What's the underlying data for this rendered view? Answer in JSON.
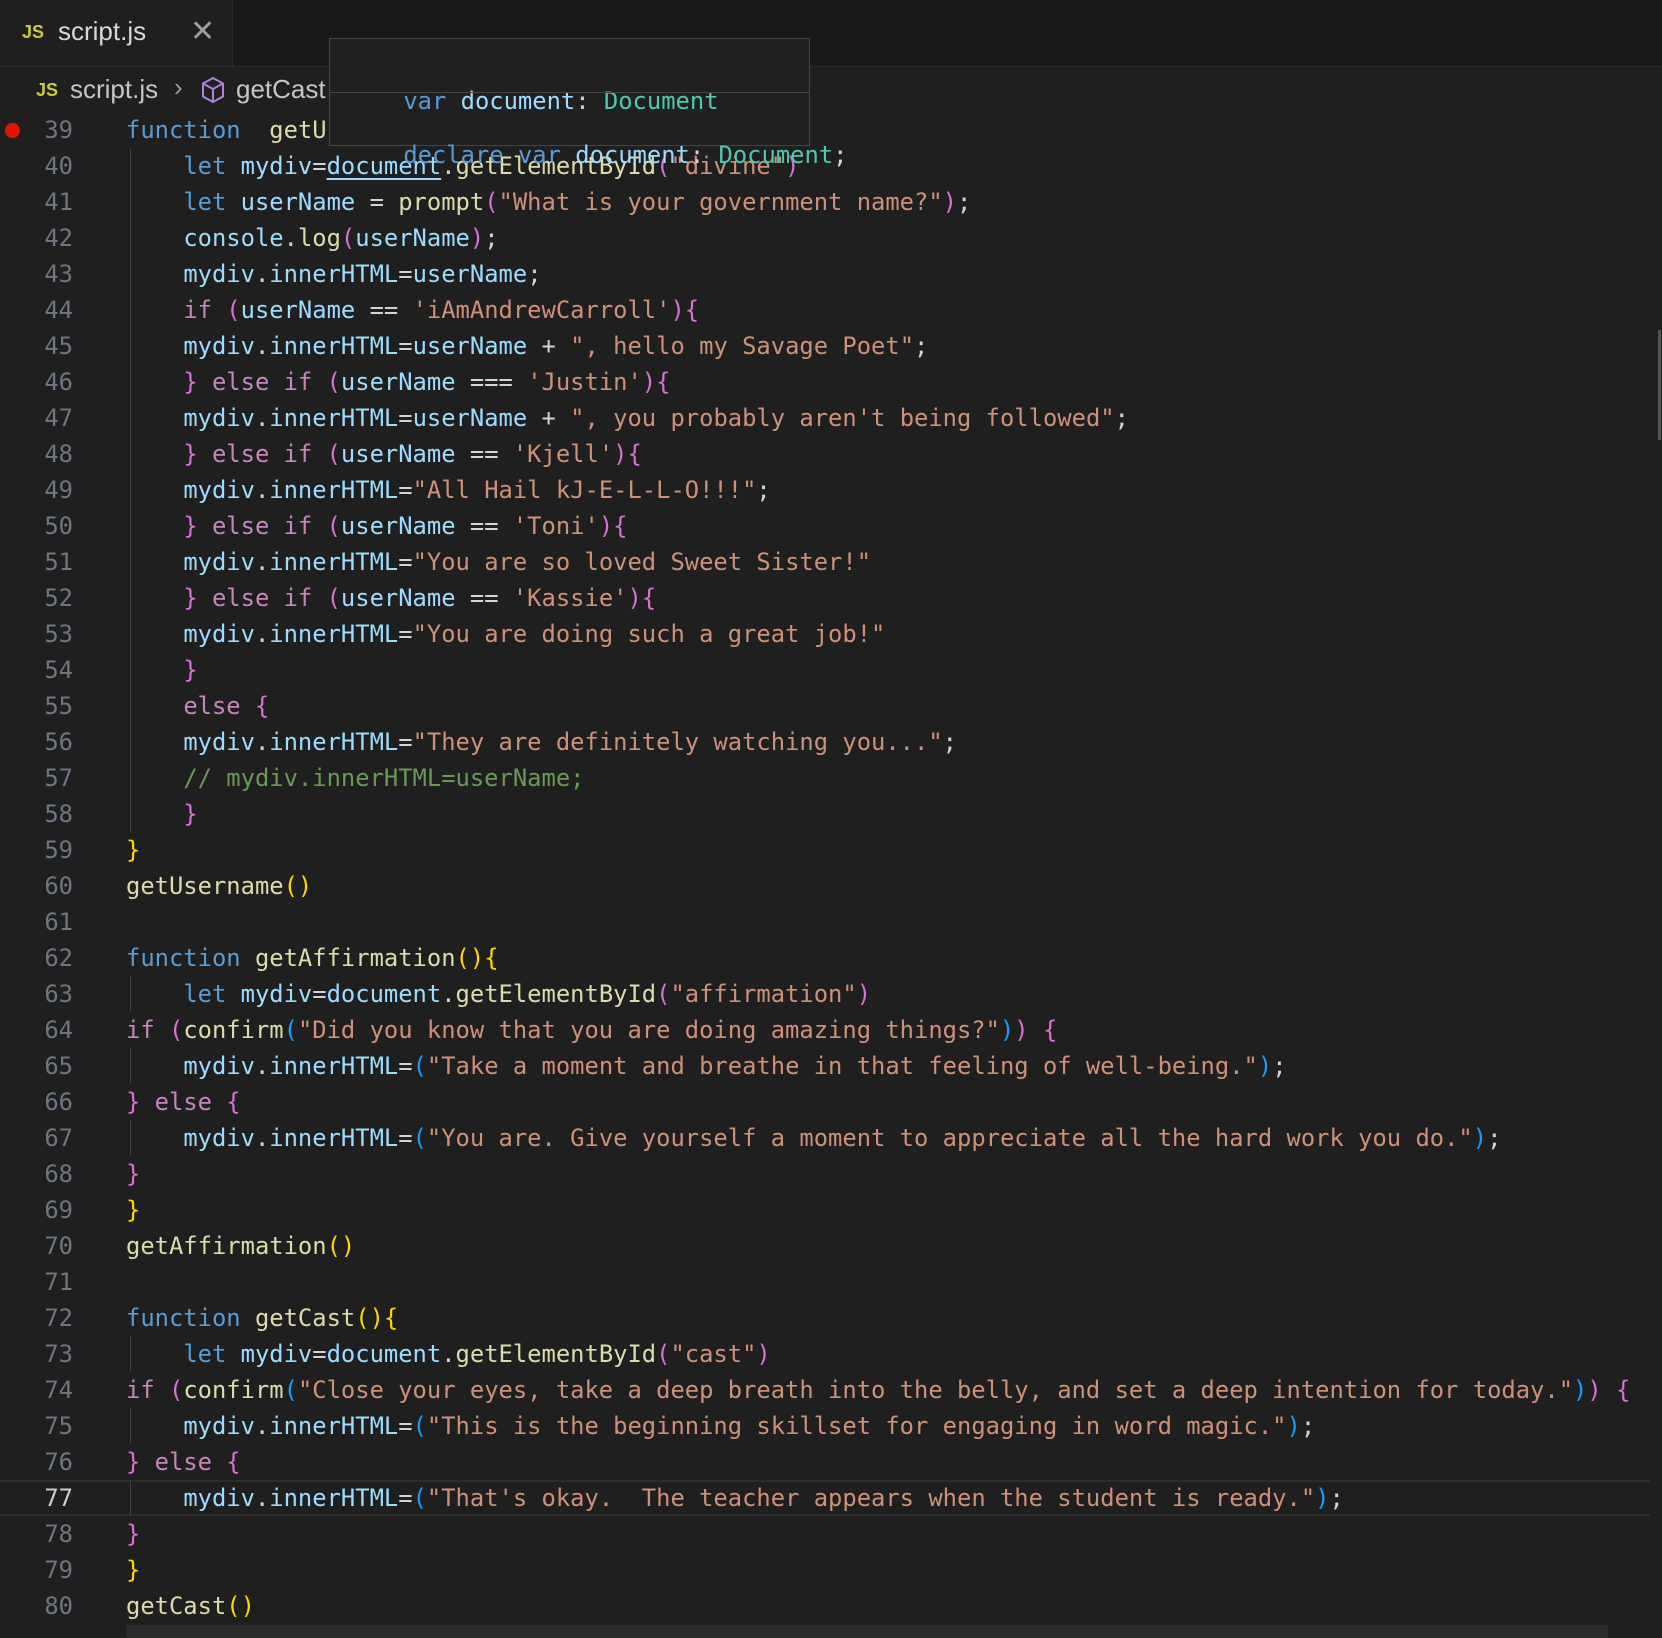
{
  "tab": {
    "icon": "JS",
    "title": "script.js",
    "close": "✕"
  },
  "breadcrumb": {
    "icon": "JS",
    "file": "script.js",
    "separator": "›",
    "symbol_icon": "symbol-method-icon",
    "symbol": "getCast"
  },
  "hover": {
    "line1": [
      "var",
      " ",
      "document",
      ": ",
      "Document"
    ],
    "line2": [
      "declare",
      " ",
      "var",
      " ",
      "document",
      ": ",
      "Document",
      ";"
    ]
  },
  "editor": {
    "current_line": 77,
    "breakpoint_line": 39,
    "lines": [
      {
        "n": "39",
        "t": [
          [
            "kw",
            "function"
          ],
          [
            "",
            "  "
          ],
          [
            "fn",
            "getUs"
          ]
        ]
      },
      {
        "n": "40",
        "t": [
          [
            "",
            "    "
          ],
          [
            "kw",
            "let"
          ],
          [
            "",
            " "
          ],
          [
            "var",
            "mydiv"
          ],
          [
            "",
            "="
          ],
          [
            "var ul",
            "document"
          ],
          [
            "",
            "."
          ],
          [
            "fn",
            "getElementById"
          ],
          [
            "p2",
            "("
          ],
          [
            "str",
            "\"divine\""
          ],
          [
            "p2",
            ")"
          ]
        ]
      },
      {
        "n": "41",
        "t": [
          [
            "",
            "    "
          ],
          [
            "kw",
            "let"
          ],
          [
            "",
            " "
          ],
          [
            "var",
            "userName"
          ],
          [
            "",
            " = "
          ],
          [
            "fn",
            "prompt"
          ],
          [
            "p2",
            "("
          ],
          [
            "str",
            "\"What is your government name?\""
          ],
          [
            "p2",
            ")"
          ],
          [
            "",
            ";"
          ]
        ]
      },
      {
        "n": "42",
        "t": [
          [
            "",
            "    "
          ],
          [
            "var",
            "console"
          ],
          [
            "",
            "."
          ],
          [
            "fn",
            "log"
          ],
          [
            "p2",
            "("
          ],
          [
            "var",
            "userName"
          ],
          [
            "p2",
            ")"
          ],
          [
            "",
            ";"
          ]
        ]
      },
      {
        "n": "43",
        "t": [
          [
            "",
            "    "
          ],
          [
            "var",
            "mydiv"
          ],
          [
            "",
            "."
          ],
          [
            "var",
            "innerHTML"
          ],
          [
            "",
            "="
          ],
          [
            "var",
            "userName"
          ],
          [
            "",
            ";"
          ]
        ]
      },
      {
        "n": "44",
        "t": [
          [
            "",
            "    "
          ],
          [
            "ctl",
            "if"
          ],
          [
            "",
            " "
          ],
          [
            "p2",
            "("
          ],
          [
            "var",
            "userName"
          ],
          [
            "",
            " == "
          ],
          [
            "str",
            "'iAmAndrewCarroll'"
          ],
          [
            "p2",
            ")"
          ],
          [
            "p2",
            "{"
          ]
        ]
      },
      {
        "n": "45",
        "t": [
          [
            "",
            "    "
          ],
          [
            "var",
            "mydiv"
          ],
          [
            "",
            "."
          ],
          [
            "var",
            "innerHTML"
          ],
          [
            "",
            "="
          ],
          [
            "var",
            "userName"
          ],
          [
            "",
            " + "
          ],
          [
            "str",
            "\", hello my Savage Poet\""
          ],
          [
            "",
            ";"
          ]
        ]
      },
      {
        "n": "46",
        "t": [
          [
            "",
            "    "
          ],
          [
            "p2",
            "}"
          ],
          [
            "",
            " "
          ],
          [
            "ctl",
            "else if"
          ],
          [
            "",
            " "
          ],
          [
            "p2",
            "("
          ],
          [
            "var",
            "userName"
          ],
          [
            "",
            " === "
          ],
          [
            "str",
            "'Justin'"
          ],
          [
            "p2",
            ")"
          ],
          [
            "p2",
            "{"
          ]
        ]
      },
      {
        "n": "47",
        "t": [
          [
            "",
            "    "
          ],
          [
            "var",
            "mydiv"
          ],
          [
            "",
            "."
          ],
          [
            "var",
            "innerHTML"
          ],
          [
            "",
            "="
          ],
          [
            "var",
            "userName"
          ],
          [
            "",
            " + "
          ],
          [
            "str",
            "\", you probably aren't being followed\""
          ],
          [
            "",
            ";"
          ]
        ]
      },
      {
        "n": "48",
        "t": [
          [
            "",
            "    "
          ],
          [
            "p2",
            "}"
          ],
          [
            "",
            " "
          ],
          [
            "ctl",
            "else if"
          ],
          [
            "",
            " "
          ],
          [
            "p2",
            "("
          ],
          [
            "var",
            "userName"
          ],
          [
            "",
            " == "
          ],
          [
            "str",
            "'Kjell'"
          ],
          [
            "p2",
            ")"
          ],
          [
            "p2",
            "{"
          ]
        ]
      },
      {
        "n": "49",
        "t": [
          [
            "",
            "    "
          ],
          [
            "var",
            "mydiv"
          ],
          [
            "",
            "."
          ],
          [
            "var",
            "innerHTML"
          ],
          [
            "",
            "="
          ],
          [
            "str",
            "\"All Hail kJ-E-L-L-O!!!\""
          ],
          [
            "",
            ";"
          ]
        ]
      },
      {
        "n": "50",
        "t": [
          [
            "",
            "    "
          ],
          [
            "p2",
            "}"
          ],
          [
            "",
            " "
          ],
          [
            "ctl",
            "else if"
          ],
          [
            "",
            " "
          ],
          [
            "p2",
            "("
          ],
          [
            "var",
            "userName"
          ],
          [
            "",
            " == "
          ],
          [
            "str",
            "'Toni'"
          ],
          [
            "p2",
            ")"
          ],
          [
            "p2",
            "{"
          ]
        ]
      },
      {
        "n": "51",
        "t": [
          [
            "",
            "    "
          ],
          [
            "var",
            "mydiv"
          ],
          [
            "",
            "."
          ],
          [
            "var",
            "innerHTML"
          ],
          [
            "",
            "="
          ],
          [
            "str",
            "\"You are so loved Sweet Sister!\""
          ]
        ]
      },
      {
        "n": "52",
        "t": [
          [
            "",
            "    "
          ],
          [
            "p2",
            "}"
          ],
          [
            "",
            " "
          ],
          [
            "ctl",
            "else if"
          ],
          [
            "",
            " "
          ],
          [
            "p2",
            "("
          ],
          [
            "var",
            "userName"
          ],
          [
            "",
            " == "
          ],
          [
            "str",
            "'Kassie'"
          ],
          [
            "p2",
            ")"
          ],
          [
            "p2",
            "{"
          ]
        ]
      },
      {
        "n": "53",
        "t": [
          [
            "",
            "    "
          ],
          [
            "var",
            "mydiv"
          ],
          [
            "",
            "."
          ],
          [
            "var",
            "innerHTML"
          ],
          [
            "",
            "="
          ],
          [
            "str",
            "\"You are doing such a great job!\""
          ]
        ]
      },
      {
        "n": "54",
        "t": [
          [
            "",
            "    "
          ],
          [
            "p2",
            "}"
          ]
        ]
      },
      {
        "n": "55",
        "t": [
          [
            "",
            "    "
          ],
          [
            "ctl",
            "else"
          ],
          [
            "",
            " "
          ],
          [
            "p2",
            "{"
          ]
        ]
      },
      {
        "n": "56",
        "t": [
          [
            "",
            "    "
          ],
          [
            "var",
            "mydiv"
          ],
          [
            "",
            "."
          ],
          [
            "var",
            "innerHTML"
          ],
          [
            "",
            "="
          ],
          [
            "str",
            "\"They are definitely watching you...\""
          ],
          [
            "",
            ";"
          ]
        ]
      },
      {
        "n": "57",
        "t": [
          [
            "",
            "    "
          ],
          [
            "cm",
            "// mydiv.innerHTML=userName;"
          ]
        ]
      },
      {
        "n": "58",
        "t": [
          [
            "",
            "    "
          ],
          [
            "p2",
            "}"
          ]
        ]
      },
      {
        "n": "59",
        "t": [
          [
            "p1",
            "}"
          ]
        ]
      },
      {
        "n": "60",
        "t": [
          [
            "fn",
            "getUsername"
          ],
          [
            "p1",
            "()"
          ]
        ]
      },
      {
        "n": "61",
        "t": []
      },
      {
        "n": "62",
        "t": [
          [
            "kw",
            "function"
          ],
          [
            "",
            " "
          ],
          [
            "fn",
            "getAffirmation"
          ],
          [
            "p1",
            "()"
          ],
          [
            "p1",
            "{"
          ]
        ]
      },
      {
        "n": "63",
        "t": [
          [
            "",
            "    "
          ],
          [
            "kw",
            "let"
          ],
          [
            "",
            " "
          ],
          [
            "var",
            "mydiv"
          ],
          [
            "",
            "="
          ],
          [
            "var",
            "document"
          ],
          [
            "",
            "."
          ],
          [
            "fn",
            "getElementById"
          ],
          [
            "p2",
            "("
          ],
          [
            "str",
            "\"affirmation\""
          ],
          [
            "p2",
            ")"
          ]
        ]
      },
      {
        "n": "64",
        "t": [
          [
            "ctl",
            "if"
          ],
          [
            "",
            " "
          ],
          [
            "p2",
            "("
          ],
          [
            "fn",
            "confirm"
          ],
          [
            "p3",
            "("
          ],
          [
            "str",
            "\"Did you know that you are doing amazing things?\""
          ],
          [
            "p3",
            ")"
          ],
          [
            "p2",
            ")"
          ],
          [
            "",
            " "
          ],
          [
            "p2",
            "{"
          ]
        ]
      },
      {
        "n": "65",
        "t": [
          [
            "",
            "    "
          ],
          [
            "var",
            "mydiv"
          ],
          [
            "",
            "."
          ],
          [
            "var",
            "innerHTML"
          ],
          [
            "",
            "="
          ],
          [
            "p3",
            "("
          ],
          [
            "str",
            "\"Take a moment and breathe in that feeling of well-being.\""
          ],
          [
            "p3",
            ")"
          ],
          [
            "",
            ";"
          ]
        ]
      },
      {
        "n": "66",
        "t": [
          [
            "p2",
            "}"
          ],
          [
            "",
            " "
          ],
          [
            "ctl",
            "else"
          ],
          [
            "",
            " "
          ],
          [
            "p2",
            "{"
          ]
        ]
      },
      {
        "n": "67",
        "t": [
          [
            "",
            "    "
          ],
          [
            "var",
            "mydiv"
          ],
          [
            "",
            "."
          ],
          [
            "var",
            "innerHTML"
          ],
          [
            "",
            "="
          ],
          [
            "p3",
            "("
          ],
          [
            "str",
            "\"You are. Give yourself a moment to appreciate all the hard work you do.\""
          ],
          [
            "p3",
            ")"
          ],
          [
            "",
            ";"
          ]
        ]
      },
      {
        "n": "68",
        "t": [
          [
            "p2",
            "}"
          ]
        ]
      },
      {
        "n": "69",
        "t": [
          [
            "p1",
            "}"
          ]
        ]
      },
      {
        "n": "70",
        "t": [
          [
            "fn",
            "getAffirmation"
          ],
          [
            "p1",
            "()"
          ]
        ]
      },
      {
        "n": "71",
        "t": []
      },
      {
        "n": "72",
        "t": [
          [
            "kw",
            "function"
          ],
          [
            "",
            " "
          ],
          [
            "fn",
            "getCast"
          ],
          [
            "p1",
            "()"
          ],
          [
            "p1",
            "{"
          ]
        ]
      },
      {
        "n": "73",
        "t": [
          [
            "",
            "    "
          ],
          [
            "kw",
            "let"
          ],
          [
            "",
            " "
          ],
          [
            "var",
            "mydiv"
          ],
          [
            "",
            "="
          ],
          [
            "var",
            "document"
          ],
          [
            "",
            "."
          ],
          [
            "fn",
            "getElementById"
          ],
          [
            "p2",
            "("
          ],
          [
            "str",
            "\"cast\""
          ],
          [
            "p2",
            ")"
          ]
        ]
      },
      {
        "n": "74",
        "t": [
          [
            "ctl",
            "if"
          ],
          [
            "",
            " "
          ],
          [
            "p2",
            "("
          ],
          [
            "fn",
            "confirm"
          ],
          [
            "p3",
            "("
          ],
          [
            "str",
            "\"Close your eyes, take a deep breath into the belly, and set a deep intention for today.\""
          ],
          [
            "p3",
            ")"
          ],
          [
            "p2",
            ")"
          ],
          [
            "",
            " "
          ],
          [
            "p2",
            "{"
          ]
        ]
      },
      {
        "n": "75",
        "t": [
          [
            "",
            "    "
          ],
          [
            "var",
            "mydiv"
          ],
          [
            "",
            "."
          ],
          [
            "var",
            "innerHTML"
          ],
          [
            "",
            "="
          ],
          [
            "p3",
            "("
          ],
          [
            "str",
            "\"This is the beginning skillset for engaging in word magic.\""
          ],
          [
            "p3",
            ")"
          ],
          [
            "",
            ";"
          ]
        ]
      },
      {
        "n": "76",
        "t": [
          [
            "p2",
            "}"
          ],
          [
            "",
            " "
          ],
          [
            "ctl",
            "else"
          ],
          [
            "",
            " "
          ],
          [
            "p2",
            "{"
          ]
        ]
      },
      {
        "n": "77",
        "t": [
          [
            "",
            "    "
          ],
          [
            "var",
            "mydiv"
          ],
          [
            "",
            "."
          ],
          [
            "var",
            "innerHTML"
          ],
          [
            "",
            "="
          ],
          [
            "p3",
            "("
          ],
          [
            "str",
            "\"That's okay.  The teacher appears when the student is ready.\""
          ],
          [
            "p3",
            ")"
          ],
          [
            "",
            ";"
          ]
        ]
      },
      {
        "n": "78",
        "t": [
          [
            "p2",
            "}"
          ]
        ]
      },
      {
        "n": "79",
        "t": [
          [
            "p1",
            "}"
          ]
        ]
      },
      {
        "n": "80",
        "t": [
          [
            "fn",
            "getCast"
          ],
          [
            "p1",
            "()"
          ]
        ]
      }
    ]
  }
}
